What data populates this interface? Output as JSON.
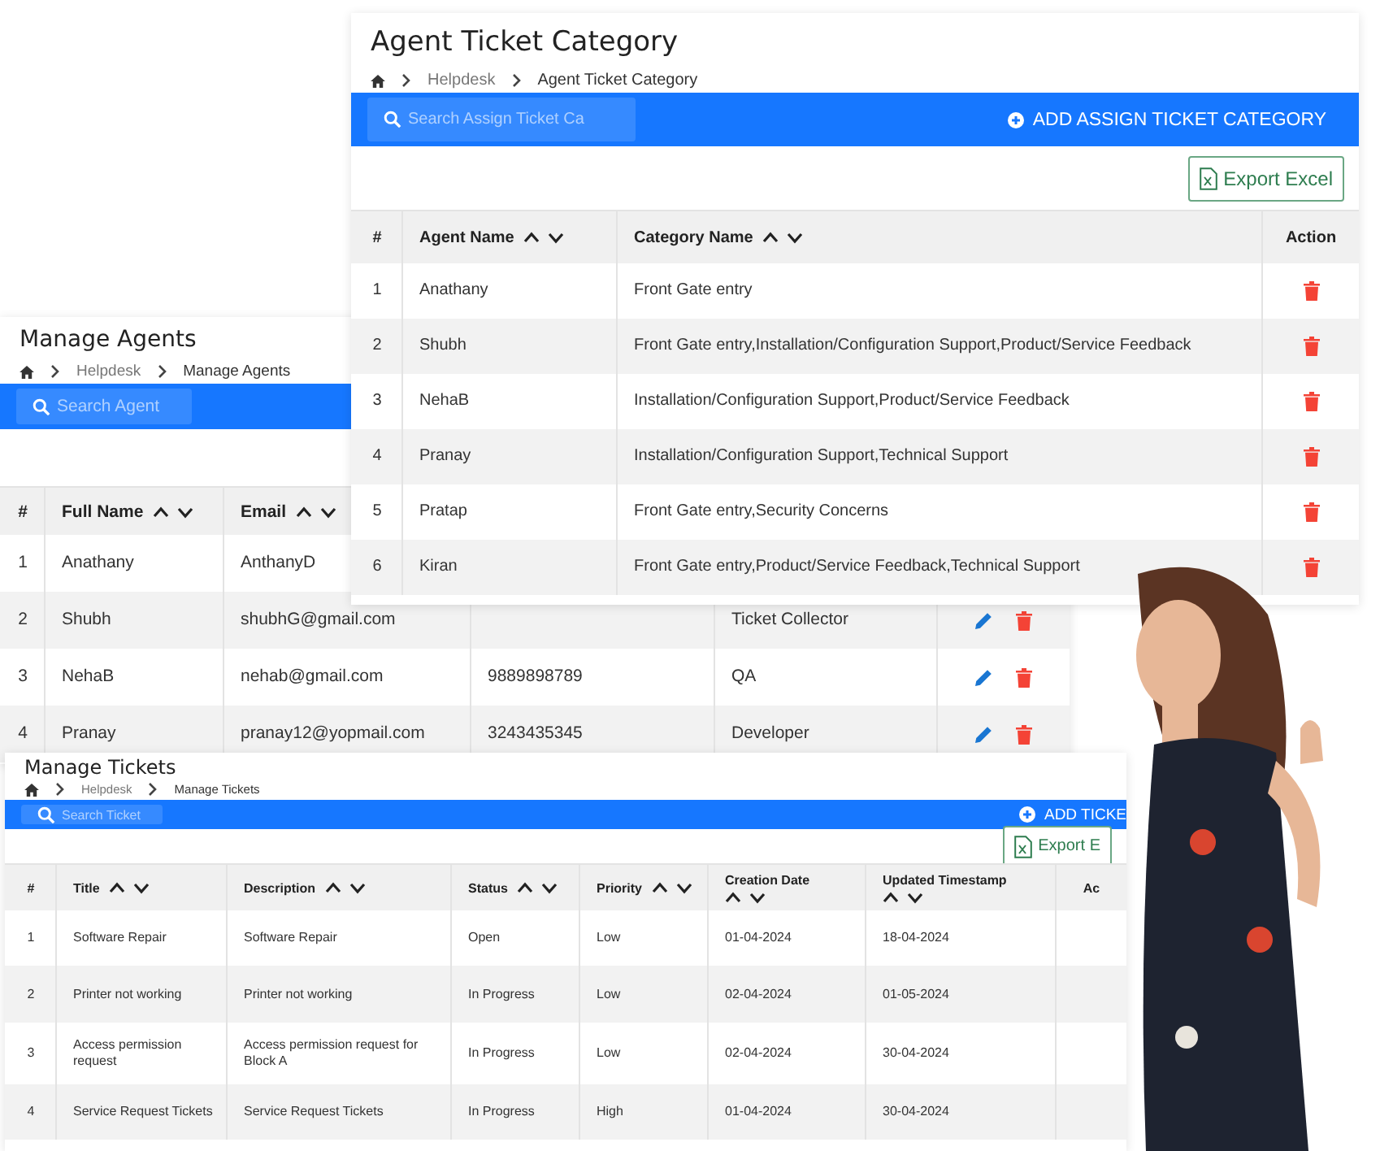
{
  "manage_agents": {
    "title": "Manage Agents",
    "breadcrumb": [
      "Helpdesk",
      "Manage Agents"
    ],
    "search": {
      "placeholder": "Search Agent"
    },
    "table": {
      "columns": [
        {
          "label": "#",
          "sortable": false
        },
        {
          "label": "Full Name",
          "sortable": true
        },
        {
          "label": "Email",
          "sortable": true
        }
      ],
      "rows": [
        {
          "num": "1",
          "full_name": "Anathany",
          "email": "AnthanyD"
        },
        {
          "num": "2",
          "full_name": "Shubh",
          "email": "shubhG@gmail.com",
          "role": "Ticket Collector",
          "actions": [
            {
              "kind": "edit"
            },
            {
              "kind": "delete"
            }
          ]
        },
        {
          "num": "3",
          "full_name": "NehaB",
          "email": "nehab@gmail.com",
          "phone": "9889898789",
          "role": "QA",
          "actions": [
            {
              "kind": "edit"
            },
            {
              "kind": "delete"
            }
          ]
        },
        {
          "num": "4",
          "full_name": "Pranay",
          "email": "pranay12@yopmail.com",
          "phone": "3243435345",
          "role": "Developer",
          "actions": [
            {
              "kind": "edit"
            },
            {
              "kind": "delete"
            }
          ]
        }
      ]
    }
  },
  "agent_ticket_category": {
    "title": "Agent Ticket Category",
    "breadcrumb": [
      "Helpdesk",
      "Agent Ticket Category"
    ],
    "search": {
      "placeholder": "Search Assign Ticket Ca"
    },
    "add_button": "ADD ASSIGN TICKET CATEGORY",
    "export_button": "Export Excel",
    "table": {
      "columns": [
        {
          "label": "#",
          "sortable": false
        },
        {
          "label": "Agent Name",
          "sortable": true
        },
        {
          "label": "Category Name",
          "sortable": true
        },
        {
          "label": "Action",
          "sortable": false
        }
      ],
      "rows": [
        {
          "num": "1",
          "agent": "Anathany",
          "category": "Front Gate entry",
          "actions": [
            {
              "kind": "delete"
            }
          ]
        },
        {
          "num": "2",
          "agent": "Shubh",
          "category": "Front Gate entry,Installation/Configuration Support,Product/Service Feedback",
          "actions": [
            {
              "kind": "delete"
            }
          ]
        },
        {
          "num": "3",
          "agent": "NehaB",
          "category": "Installation/Configuration Support,Product/Service Feedback",
          "actions": [
            {
              "kind": "delete"
            }
          ]
        },
        {
          "num": "4",
          "agent": "Pranay",
          "category": "Installation/Configuration Support,Technical Support",
          "actions": [
            {
              "kind": "delete"
            }
          ]
        },
        {
          "num": "5",
          "agent": "Pratap",
          "category": "Front Gate entry,Security Concerns",
          "actions": [
            {
              "kind": "delete"
            }
          ]
        },
        {
          "num": "6",
          "agent": "Kiran",
          "category": "Front Gate entry,Product/Service Feedback,Technical Support",
          "actions": [
            {
              "kind": "delete"
            }
          ]
        }
      ]
    }
  },
  "manage_tickets": {
    "title": "Manage Tickets",
    "breadcrumb": [
      "Helpdesk",
      "Manage Tickets"
    ],
    "search": {
      "placeholder": "Search Ticket"
    },
    "add_button": "ADD TICKE",
    "export_button": "Export E",
    "table": {
      "columns": [
        {
          "label": "#",
          "sortable": false
        },
        {
          "label": "Title",
          "sortable": true
        },
        {
          "label": "Description",
          "sortable": true
        },
        {
          "label": "Status",
          "sortable": true
        },
        {
          "label": "Priority",
          "sortable": true
        },
        {
          "label": "Creation Date",
          "sortable": true
        },
        {
          "label": "Updated Timestamp",
          "sortable": true
        },
        {
          "label": "Ac",
          "sortable": false
        }
      ],
      "rows": [
        {
          "num": "1",
          "title": "Software Repair",
          "description": "Software Repair",
          "status": "Open",
          "priority": "Low",
          "created": "01-04-2024",
          "updated": "18-04-2024"
        },
        {
          "num": "2",
          "title": "Printer not working",
          "description": "Printer not working",
          "status": "In Progress",
          "priority": "Low",
          "created": "02-04-2024",
          "updated": "01-05-2024"
        },
        {
          "num": "3",
          "title": "Access permission request",
          "description": "Access permission request for Block A",
          "status": "In Progress",
          "priority": "Low",
          "created": "02-04-2024",
          "updated": "30-04-2024"
        },
        {
          "num": "4",
          "title": "Service Request Tickets",
          "description": "Service Request Tickets",
          "status": "In Progress",
          "priority": "High",
          "created": "01-04-2024",
          "updated": "30-04-2024"
        }
      ]
    }
  }
}
